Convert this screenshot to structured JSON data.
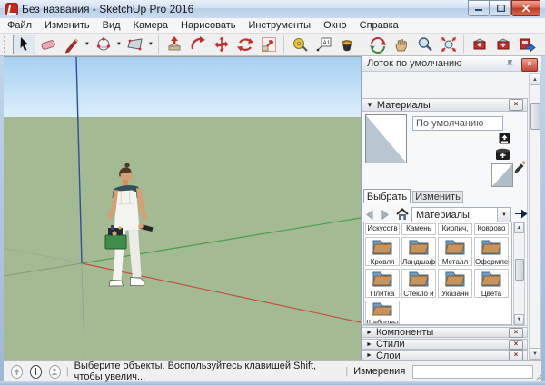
{
  "window": {
    "title": "Без названия - SketchUp Pro 2016"
  },
  "menu": {
    "items": [
      "Файл",
      "Изменить",
      "Вид",
      "Камера",
      "Нарисовать",
      "Инструменты",
      "Окно",
      "Справка"
    ]
  },
  "toolbar": {
    "tools": [
      "select",
      "eraser",
      "line",
      "arc",
      "rectangle",
      "push-pull",
      "offset",
      "move",
      "rotate",
      "scale",
      "tape-measure",
      "text",
      "paint-bucket",
      "orbit",
      "pan",
      "zoom",
      "zoom-extents",
      "get-models",
      "share-model",
      "send-to-layout"
    ]
  },
  "viewport": {
    "sky_top": "#abd4f4",
    "sky_bottom": "#ddeefb",
    "ground": "#a4ba93",
    "axis_red": "#c0503f",
    "axis_green": "#46a14b",
    "axis_blue": "#2c4f9e",
    "figure": "painter-with-toolbox"
  },
  "tray": {
    "title": "Лоток по умолчанию",
    "materials": {
      "title": "Материалы",
      "current": "По умолчанию",
      "tabs": [
        "Выбрать",
        "Изменить"
      ],
      "collection": "Материалы",
      "partial_row": [
        "Искусств",
        "Камень",
        "Кирпич,",
        "Коврово"
      ],
      "folders": [
        "Кровля",
        "Ландшаф",
        "Металл",
        "Оформле",
        "Плитка",
        "Стекло и",
        "Указанн",
        "Цвета",
        "Шаблоны"
      ]
    },
    "sections": [
      {
        "label": "Компоненты"
      },
      {
        "label": "Стили"
      },
      {
        "label": "Слои"
      }
    ]
  },
  "statusbar": {
    "message": "Выберите объекты. Воспользуйтесь клавишей Shift, чтобы увелич...",
    "measure_label": "Измерения"
  }
}
